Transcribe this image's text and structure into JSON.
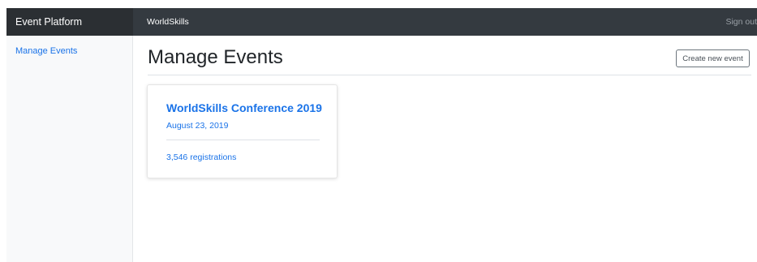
{
  "navbar": {
    "brand": "Event Platform",
    "organizer": "WorldSkills",
    "signout_label": "Sign out"
  },
  "sidebar": {
    "items": [
      {
        "label": "Manage Events"
      }
    ]
  },
  "main": {
    "title": "Manage Events",
    "create_button_label": "Create new event",
    "events": [
      {
        "name": "WorldSkills Conference 2019",
        "date": "August 23, 2019",
        "registrations": "3,546 registrations"
      }
    ]
  },
  "colors": {
    "navbar_bg": "#343a40",
    "brand_bg": "#2b2f33",
    "link": "#1a73e8",
    "sidebar_bg": "#f8f9fa"
  }
}
